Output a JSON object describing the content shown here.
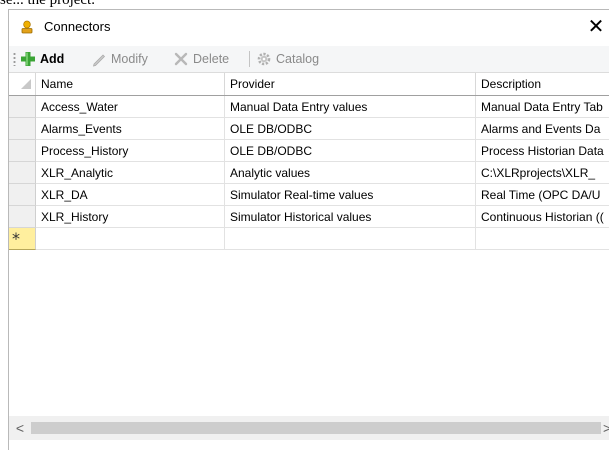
{
  "top_caption": "se... the project.",
  "window": {
    "title": "Connectors",
    "title_icon": "connector-plug-icon",
    "close_label": "✕"
  },
  "toolbar": {
    "add_label": "Add",
    "modify_label": "Modify",
    "delete_label": "Delete",
    "catalog_label": "Catalog"
  },
  "grid": {
    "columns": [
      "Name",
      "Provider",
      "Description"
    ],
    "sorted_column": "Name",
    "sort_direction": "ascending",
    "rows": [
      {
        "name": "Access_Water",
        "provider": "Manual Data Entry values",
        "description": "Manual Data Entry Tab"
      },
      {
        "name": "Alarms_Events",
        "provider": "OLE DB/ODBC",
        "description": "Alarms and Events Da"
      },
      {
        "name": "Process_History",
        "provider": "OLE DB/ODBC",
        "description": "Process Historian Data"
      },
      {
        "name": "XLR_Analytic",
        "provider": "Analytic values",
        "description": "C:\\XLRprojects\\XLR_"
      },
      {
        "name": "XLR_DA",
        "provider": "Simulator Real-time values",
        "description": "Real Time (OPC DA/U"
      },
      {
        "name": "XLR_History",
        "provider": "Simulator Historical values",
        "description": "Continuous Historian (("
      }
    ],
    "new_row_marker": "*"
  },
  "scrollbar": {
    "left_arrow": "<",
    "right_arrow": ">"
  },
  "colors": {
    "new_row_header": "#ffef9e",
    "add_icon": "#3aa435",
    "title_icon": "#e3a21a"
  }
}
